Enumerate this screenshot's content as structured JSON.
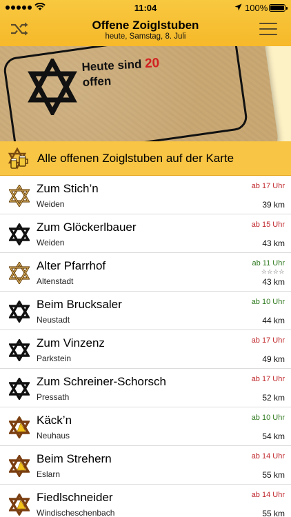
{
  "status": {
    "time": "11:04",
    "battery": "100%"
  },
  "nav": {
    "title": "Offene Zoiglstuben",
    "subtitle": "heute,  Samstag, 8. Juli"
  },
  "banner": {
    "line1": "Heute sind",
    "count": "20",
    "line2": "offen"
  },
  "map_row": {
    "label": "Alle offenen Zoiglstuben auf der Karte"
  },
  "colors": {
    "accent": "#f8c544",
    "open_red": "#c0282d",
    "open_green": "#2f7a1f"
  },
  "list": [
    {
      "name": "Zum Stich’n",
      "town": "Weiden",
      "time": "ab 17 Uhr",
      "time_color": "red",
      "distance": "39 km",
      "rating": "",
      "icon": "brown-outline-star-icon"
    },
    {
      "name": "Zum Glöckerlbauer",
      "town": "Weiden",
      "time": "ab 15 Uhr",
      "time_color": "red",
      "distance": "43 km",
      "rating": "",
      "icon": "black-star-icon"
    },
    {
      "name": "Alter Pfarrhof",
      "town": "Altenstadt",
      "time": "ab 11 Uhr",
      "time_color": "green",
      "distance": "43 km",
      "rating": "☆☆☆☆",
      "icon": "brown-outline-star-icon"
    },
    {
      "name": "Beim Brucksaler",
      "town": "Neustadt",
      "time": "ab 10 Uhr",
      "time_color": "green",
      "distance": "44 km",
      "rating": "",
      "icon": "black-star-icon"
    },
    {
      "name": "Zum Vinzenz",
      "town": "Parkstein",
      "time": "ab 17 Uhr",
      "time_color": "red",
      "distance": "49 km",
      "rating": "",
      "icon": "black-star-icon"
    },
    {
      "name": "Zum Schreiner-Schorsch",
      "town": "Pressath",
      "time": "ab 17 Uhr",
      "time_color": "red",
      "distance": "52 km",
      "rating": "",
      "icon": "black-star-icon"
    },
    {
      "name": "Käck’n",
      "town": "Neuhaus",
      "time": "ab 10 Uhr",
      "time_color": "green",
      "distance": "54 km",
      "rating": "",
      "icon": "gold-brown-star-icon"
    },
    {
      "name": "Beim Strehern",
      "town": "Eslarn",
      "time": "ab 14 Uhr",
      "time_color": "red",
      "distance": "55 km",
      "rating": "",
      "icon": "gold-brown-star-icon"
    },
    {
      "name": "Fiedlschneider",
      "town": "Windischeschenbach",
      "time": "ab 14 Uhr",
      "time_color": "red",
      "distance": "55 km",
      "rating": "",
      "icon": "gold-brown-star-icon"
    }
  ]
}
